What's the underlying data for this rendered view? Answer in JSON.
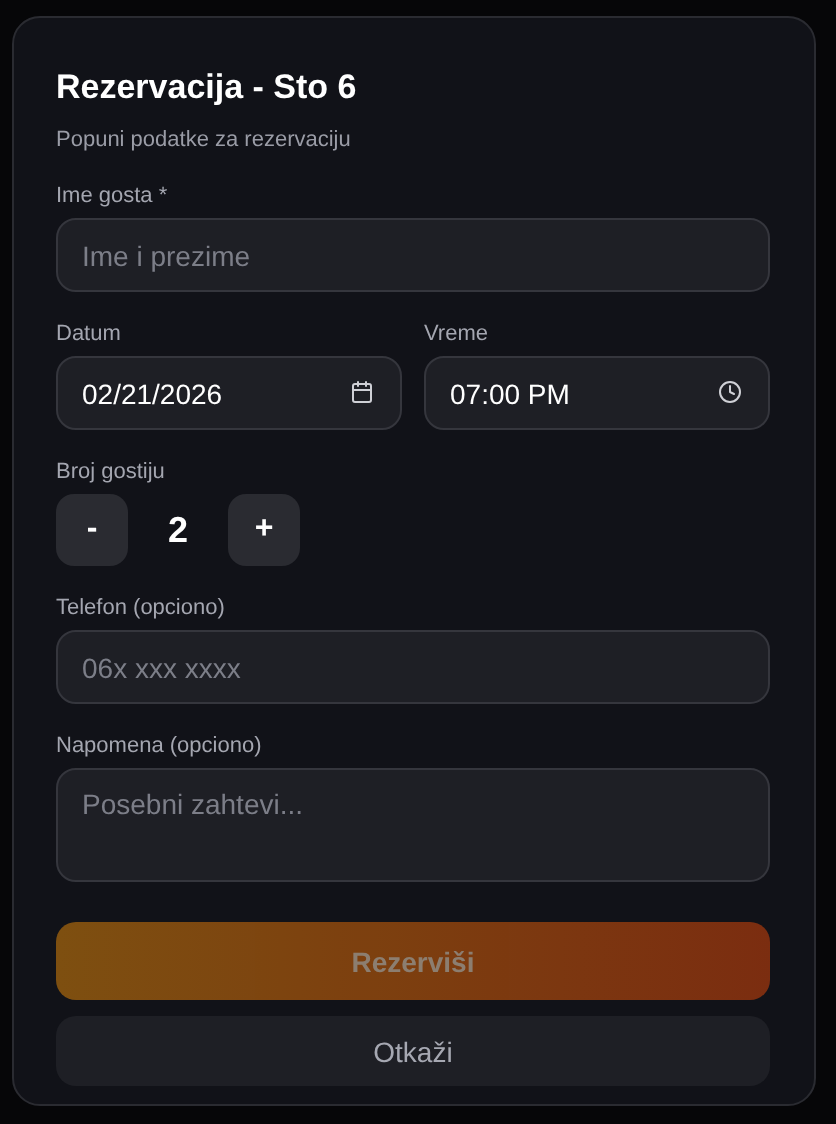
{
  "dialog": {
    "title": "Rezervacija - Sto 6",
    "subtitle": "Popuni podatke za rezervaciju"
  },
  "fields": [
    {
      "kind": "text",
      "label": "Ime gosta *",
      "placeholder": "Ime i prezime"
    },
    {
      "kind": "row",
      "items": [
        {
          "kind": "date",
          "label": "Datum",
          "value": "02/21/2026"
        },
        {
          "kind": "time",
          "label": "Vreme",
          "value": "07:00 PM"
        }
      ]
    },
    {
      "kind": "stepper",
      "label": "Broj gostiju",
      "minus": "-",
      "value": "2",
      "plus": "+"
    },
    {
      "kind": "text",
      "label": "Telefon (opciono)",
      "placeholder": "06x xxx xxxx"
    },
    {
      "kind": "textarea",
      "label": "Napomena (opciono)",
      "placeholder": "Posebni zahtevi..."
    }
  ],
  "buttons": [
    {
      "kind": "primary",
      "label": "Rezerviši",
      "disabled": true
    },
    {
      "kind": "secondary",
      "label": "Otkaži",
      "disabled": false
    }
  ]
}
